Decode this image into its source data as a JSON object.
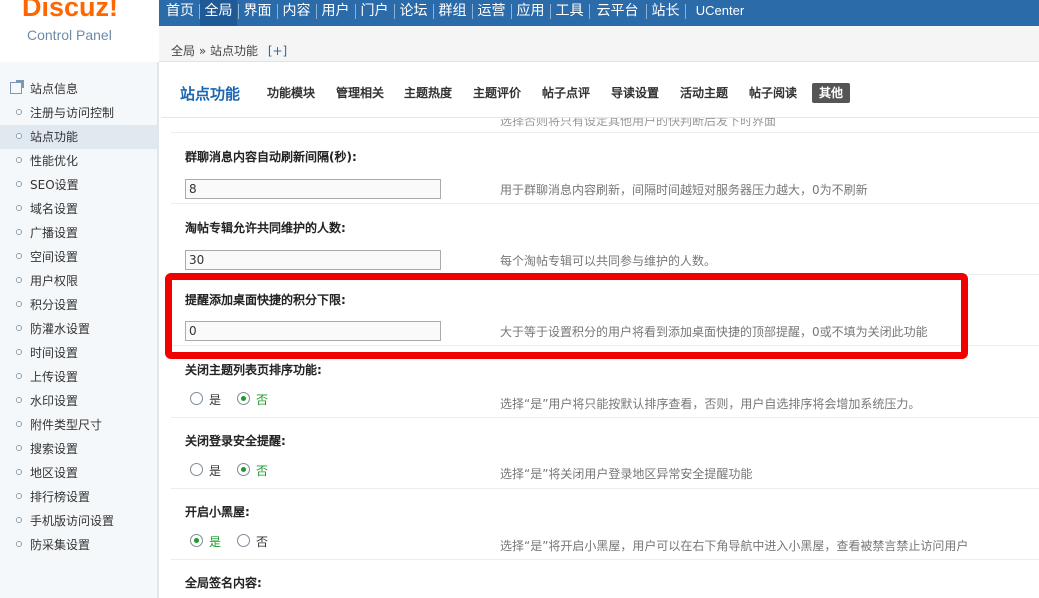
{
  "logo": {
    "brand": "Discuz!",
    "subtitle": "Control Panel"
  },
  "topnav": [
    {
      "label": "首页"
    },
    {
      "label": "全局"
    },
    {
      "label": "界面"
    },
    {
      "label": "内容"
    },
    {
      "label": "用户"
    },
    {
      "label": "门户"
    },
    {
      "label": "论坛"
    },
    {
      "label": "群组"
    },
    {
      "label": "运营"
    },
    {
      "label": "应用"
    },
    {
      "label": "工具"
    },
    {
      "label": "云平台"
    },
    {
      "label": "站长"
    },
    {
      "label": "UCenter"
    }
  ],
  "breadcrumb": {
    "path": "全局 » 站点功能",
    "add": "[+]"
  },
  "sidebar": {
    "items": [
      {
        "label": "站点信息"
      },
      {
        "label": "注册与访问控制"
      },
      {
        "label": "站点功能"
      },
      {
        "label": "性能优化"
      },
      {
        "label": "SEO设置"
      },
      {
        "label": "域名设置"
      },
      {
        "label": "广播设置"
      },
      {
        "label": "空间设置"
      },
      {
        "label": "用户权限"
      },
      {
        "label": "积分设置"
      },
      {
        "label": "防灌水设置"
      },
      {
        "label": "时间设置"
      },
      {
        "label": "上传设置"
      },
      {
        "label": "水印设置"
      },
      {
        "label": "附件类型尺寸"
      },
      {
        "label": "搜索设置"
      },
      {
        "label": "地区设置"
      },
      {
        "label": "排行榜设置"
      },
      {
        "label": "手机版访问设置"
      },
      {
        "label": "防采集设置"
      }
    ]
  },
  "main": {
    "title": "站点功能",
    "tabs": [
      {
        "label": "功能模块"
      },
      {
        "label": "管理相关"
      },
      {
        "label": "主题热度"
      },
      {
        "label": "主题评价"
      },
      {
        "label": "帖子点评"
      },
      {
        "label": "导读设置"
      },
      {
        "label": "活动主题"
      },
      {
        "label": "帖子阅读"
      },
      {
        "label": "其他"
      }
    ],
    "settings": [
      {
        "title": "群聊消息内容自动刷新间隔(秒):",
        "value": "8",
        "desc": "用于群聊消息内容刷新，间隔时间越短对服务器压力越大，0为不刷新"
      },
      {
        "title": "淘帖专辑允许共同维护的人数:",
        "value": "30",
        "desc": "每个淘帖专辑可以共同参与维护的人数。"
      },
      {
        "title": "提醒添加桌面快捷的积分下限:",
        "value": "0",
        "desc": "大于等于设置积分的用户将看到添加桌面快捷的顶部提醒，0或不填为关闭此功能"
      },
      {
        "title": "关闭主题列表页排序功能:",
        "yes": "是",
        "no": "否",
        "desc": "选择“是”用户将只能按默认排序查看，否则，用户自选排序将会增加系统压力。"
      },
      {
        "title": "关闭登录安全提醒:",
        "yes": "是",
        "no": "否",
        "desc": "选择“是”将关闭用户登录地区异常安全提醒功能"
      },
      {
        "title": "开启小黑屋:",
        "yes": "是",
        "no": "否",
        "desc": "选择“是”将开启小黑屋，用户可以在右下角导航中进入小黑屋，查看被禁言禁止访问用户"
      },
      {
        "title": "全局签名内容:"
      }
    ],
    "cut_top_desc": "选择否则将只有设定其他用户的快判断后发下时界面"
  },
  "colors": {
    "nav": "#2b6baa",
    "accent": "#f60",
    "highlight": "#f10000",
    "checked": "#1a9b2a"
  }
}
